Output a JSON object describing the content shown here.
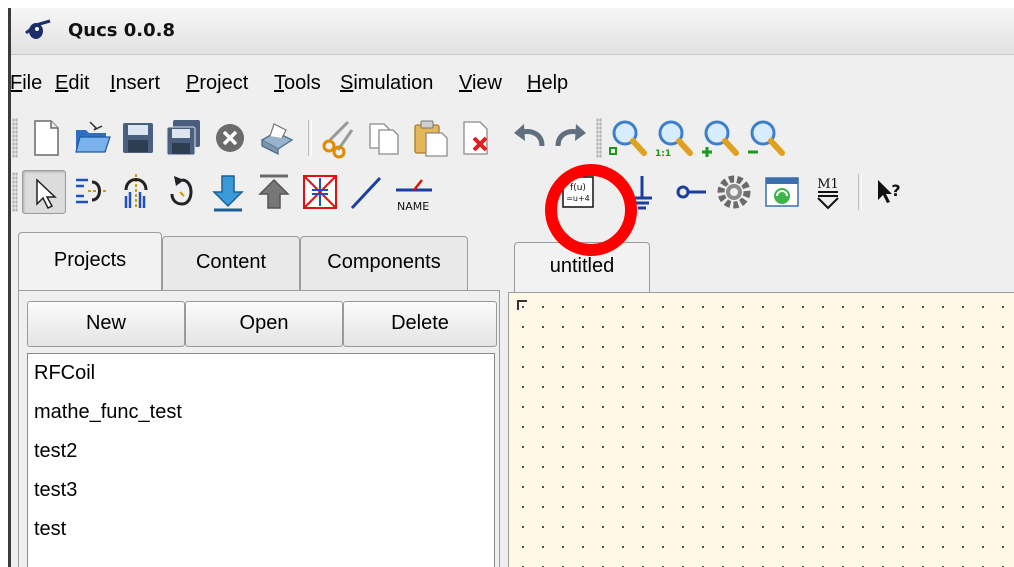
{
  "window": {
    "title": "Qucs 0.0.8"
  },
  "menu": [
    {
      "pre": "",
      "u": "F",
      "post": "ile"
    },
    {
      "pre": "",
      "u": "E",
      "post": "dit"
    },
    {
      "pre": "",
      "u": "I",
      "post": "nsert"
    },
    {
      "pre": "",
      "u": "P",
      "post": "roject"
    },
    {
      "pre": "",
      "u": "T",
      "post": "ools"
    },
    {
      "pre": "",
      "u": "S",
      "post": "imulation"
    },
    {
      "pre": "",
      "u": "V",
      "post": "iew"
    },
    {
      "pre": "",
      "u": "H",
      "post": "elp"
    }
  ],
  "toolbar1": [
    "new-document-icon",
    "open-folder-icon",
    "save-icon",
    "save-all-icon",
    "close-icon",
    "print-icon",
    "cut-icon",
    "copy-icon",
    "paste-icon",
    "delete-icon",
    "undo-icon",
    "redo-icon",
    "zoom-fit-icon",
    "zoom-1-1-icon",
    "zoom-in-icon",
    "zoom-out-icon"
  ],
  "toolbar2": {
    "tools": [
      "select-icon",
      "mirror-x-icon",
      "mirror-y-icon",
      "rotate-icon",
      "enter-subcircuit-icon",
      "exit-subcircuit-icon",
      "deactivate-icon",
      "wire-icon",
      "wire-label-icon",
      "equation-icon",
      "ground-icon",
      "port-icon",
      "simulate-icon",
      "view-data-icon",
      "marker-icon",
      "whats-this-icon"
    ],
    "wire_label_text": "NAME",
    "equation_text_top": "f(u)",
    "equation_text_bottom": "=u+4",
    "marker_text": "M1",
    "highlighted": "equation-icon"
  },
  "dock": {
    "tabs": [
      "Projects",
      "Content",
      "Components"
    ],
    "active_tab": "Projects",
    "buttons": {
      "new": "New",
      "open": "Open",
      "delete": "Delete"
    },
    "projects": [
      "RFCoil",
      "mathe_func_test",
      "test2",
      "test3",
      "test"
    ]
  },
  "document": {
    "tab_label": "untitled"
  },
  "colors": {
    "highlight": "#ff0000",
    "schematic_bg": "#fff8e7"
  }
}
